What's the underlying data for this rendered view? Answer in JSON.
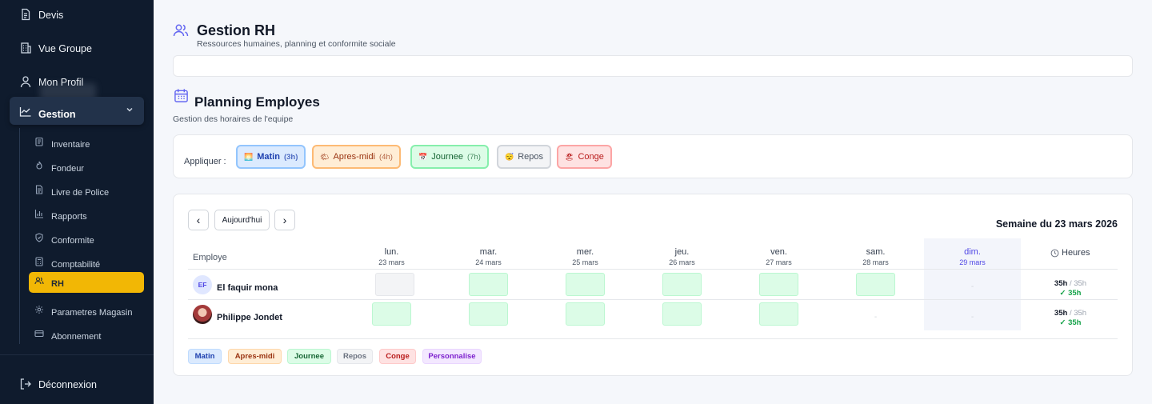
{
  "sidebar": {
    "top_items": [
      {
        "label": "Devis",
        "icon": "file-icon"
      },
      {
        "label": "Vue Groupe",
        "icon": "building-icon"
      },
      {
        "label": "Mon Profil",
        "icon": "user-icon"
      }
    ],
    "gestion": {
      "label": "Gestion",
      "icon": "chart-area-icon",
      "expanded": true
    },
    "sub_items": [
      {
        "label": "Inventaire",
        "icon": "clipboard-icon",
        "active": false
      },
      {
        "label": "Fondeur",
        "icon": "flame-icon",
        "active": false
      },
      {
        "label": "Livre de Police",
        "icon": "document-icon",
        "active": false
      },
      {
        "label": "Rapports",
        "icon": "bar-chart-icon",
        "active": false
      },
      {
        "label": "Conformite",
        "icon": "shield-icon",
        "active": false
      },
      {
        "label": "Comptabilité",
        "icon": "calculator-icon",
        "active": false
      },
      {
        "label": "RH",
        "icon": "users-icon",
        "active": true
      },
      {
        "label": "Parametres Magasin",
        "icon": "gear-icon",
        "active": false
      },
      {
        "label": "Abonnement",
        "icon": "credit-card-icon",
        "active": false
      }
    ],
    "logout": {
      "label": "Déconnexion",
      "icon": "logout-icon"
    },
    "accent_color": "#f2b705"
  },
  "header": {
    "title": "Gestion RH",
    "subtitle": "Ressources humaines, planning et conformite sociale"
  },
  "planning": {
    "title": "Planning Employes",
    "subtitle": "Gestion des horaires de l'equipe",
    "apply_label": "Appliquer :",
    "shift_chips": [
      {
        "label": "Matin",
        "hours": "(3h)",
        "emoji": "🌅"
      },
      {
        "label": "Apres-midi",
        "hours": "(4h)",
        "emoji": "🌤"
      },
      {
        "label": "Journee",
        "hours": "(7h)",
        "emoji": "📅"
      },
      {
        "label": "Repos",
        "hours": "",
        "emoji": "😴"
      },
      {
        "label": "Conge",
        "hours": "",
        "emoji": "🏖"
      }
    ],
    "nav": {
      "prev": "‹",
      "today": "Aujourd'hui",
      "next": "›"
    },
    "week_label": "Semaine du 23 mars 2026",
    "employee_header": "Employe",
    "hours_header": "Heures",
    "days": [
      {
        "name": "lun.",
        "date": "23 mars"
      },
      {
        "name": "mar.",
        "date": "24 mars"
      },
      {
        "name": "mer.",
        "date": "25 mars"
      },
      {
        "name": "jeu.",
        "date": "26 mars"
      },
      {
        "name": "ven.",
        "date": "27 mars"
      },
      {
        "name": "sam.",
        "date": "28 mars"
      },
      {
        "name": "dim.",
        "date": "29 mars"
      }
    ],
    "today_index": 6,
    "employees": [
      {
        "initials": "EF",
        "name": "El faquir mona",
        "cells": [
          "empty",
          "journee",
          "journee",
          "journee",
          "journee",
          "journee",
          "dash"
        ],
        "hours": "35h",
        "target": "/ 35h",
        "ok": "✓ 35h"
      },
      {
        "initials": "",
        "name": "Philippe Jondet",
        "cells": [
          "journee",
          "journee",
          "journee",
          "journee",
          "journee",
          "dash",
          "dash"
        ],
        "hours": "35h",
        "target": "/ 35h",
        "ok": "✓ 35h"
      }
    ],
    "legend": [
      "Matin",
      "Apres-midi",
      "Journee",
      "Repos",
      "Conge",
      "Personnalise"
    ]
  }
}
